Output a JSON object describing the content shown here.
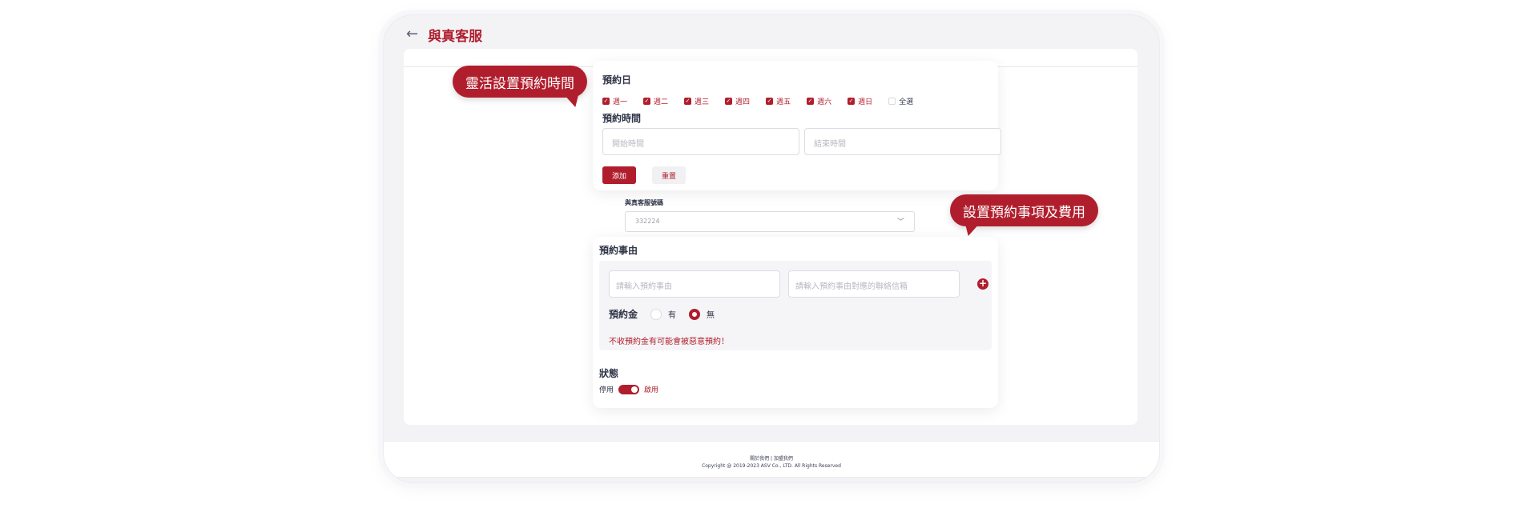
{
  "header": {
    "title": "與真客服"
  },
  "schedule": {
    "days_title": "預約日",
    "days": [
      {
        "label": "週一",
        "checked": true
      },
      {
        "label": "週二",
        "checked": true
      },
      {
        "label": "週三",
        "checked": true
      },
      {
        "label": "週四",
        "checked": true
      },
      {
        "label": "週五",
        "checked": true
      },
      {
        "label": "週六",
        "checked": true
      },
      {
        "label": "週日",
        "checked": true
      }
    ],
    "select_all": "全選",
    "time_title": "預約時間",
    "start_placeholder": "開始時間",
    "end_placeholder": "結束時間",
    "add_label": "添加",
    "reset_label": "重置"
  },
  "fax": {
    "label": "與真客服號碼",
    "value": "332224"
  },
  "reason": {
    "title": "預約事由",
    "reason_placeholder": "請輸入預約事由",
    "email_placeholder": "請輸入預約事由對應的聯絡信箱",
    "deposit_label": "預約金",
    "option_yes": "有",
    "option_no": "無",
    "selected": "無",
    "warning": "不收預約金有可能會被惡意預約！"
  },
  "status": {
    "title": "狀態",
    "off_label": "停用",
    "on_label": "啟用",
    "enabled": true
  },
  "callouts": {
    "flexible": "靈活設置預約時間",
    "fees": "設置預約事項及費用"
  },
  "footer": {
    "links": "關於我們 | 加盟我們",
    "copyright": "Copyright @ 2019-2023 ASV Co., LTD. All Rights Reserved"
  },
  "colors": {
    "accent": "#b01e2d",
    "text": "#2f3447",
    "background": "#f3f3f5"
  }
}
